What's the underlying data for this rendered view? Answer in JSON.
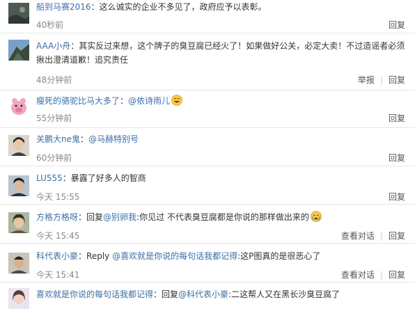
{
  "comments": [
    {
      "user": "船到马赛2016",
      "text": "：这么诚实的企业不多见了，政府应予以表彰。",
      "time": "40秒前",
      "actions": [
        "回复"
      ]
    },
    {
      "user": "AAA小舟",
      "text": "：其实反过来想，这个牌子的臭豆腐已经火了！如果做好公关，必定大卖！不过造谣者必须揪出澄清道歉！追究责任",
      "time": "48分钟前",
      "actions": [
        "举报",
        "回复"
      ]
    },
    {
      "user": "瘦死的骆驼比马大多了",
      "text": "：",
      "mention": "@依诗雨儿",
      "emoji": "laughing-emoji",
      "time": "55分钟前",
      "actions": [
        "回复"
      ]
    },
    {
      "user": "关鹏大ne鬼",
      "text": "：",
      "mention": "@马赫特别号",
      "time": "60分钟前",
      "actions": [
        "回复"
      ]
    },
    {
      "user": "LU555",
      "text": "：暴露了好多人的智商",
      "time": "今天 15:55",
      "actions": [
        "回复"
      ]
    },
    {
      "user": "方格方格呀",
      "text": "：回复",
      "mention": "@别卵我",
      "text2": ":你见过 不代表臭豆腐都是你说的那样做出来的",
      "emoji": "crying-emoji",
      "time": "今天 15:45",
      "actions": [
        "查看对话",
        "回复"
      ]
    },
    {
      "user": "科代表小豪",
      "text": "：Reply ",
      "mention": "@喜欢就是你说的每句话我都记得",
      "text2": ":这P图真的是很恶心了",
      "time": "今天 15:41",
      "actions": [
        "查看对话",
        "回复"
      ]
    },
    {
      "user": "喜欢就是你说的每句话我都记得",
      "text": "：回复",
      "mention": "@科代表小豪",
      "text2": ":二这帮人又在黑长沙臭豆腐了",
      "time": "",
      "actions": []
    }
  ],
  "colors": {
    "link": "#3a6ea5",
    "separator": "#e6e6e6"
  }
}
